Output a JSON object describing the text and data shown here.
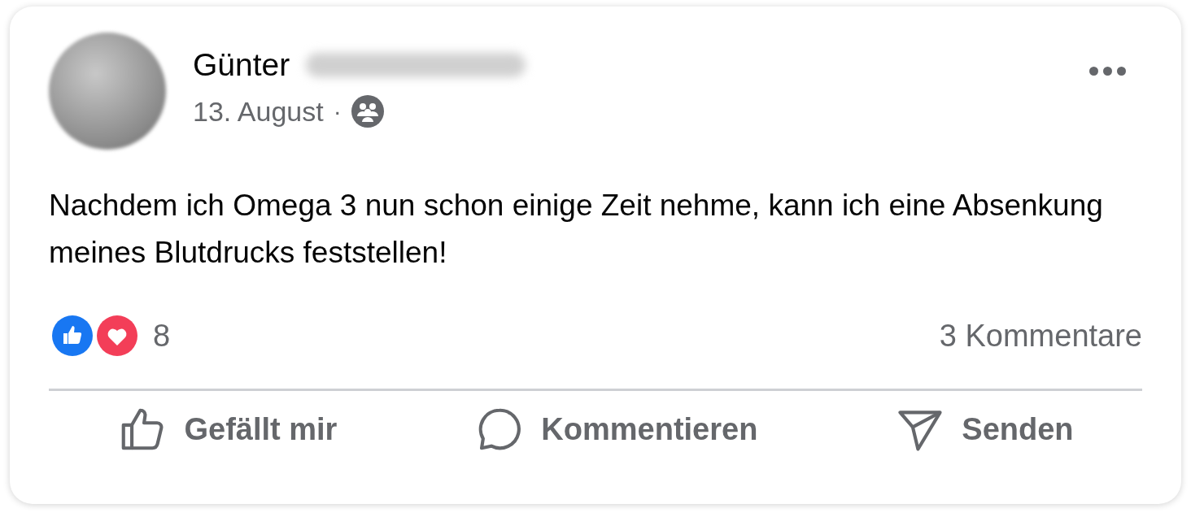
{
  "post": {
    "author": "Günter",
    "date": "13. August",
    "separator": "·",
    "text": "Nachdem ich Omega 3 nun schon einige Zeit nehme, kann ich eine Absenkung meines Blutdrucks feststellen!",
    "reaction_count": "8",
    "comments": "3 Kommentare"
  },
  "actions": [
    {
      "kind": "like",
      "label": "Gefällt mir"
    },
    {
      "kind": "comment",
      "label": "Kommentieren"
    },
    {
      "kind": "send",
      "label": "Senden"
    }
  ]
}
